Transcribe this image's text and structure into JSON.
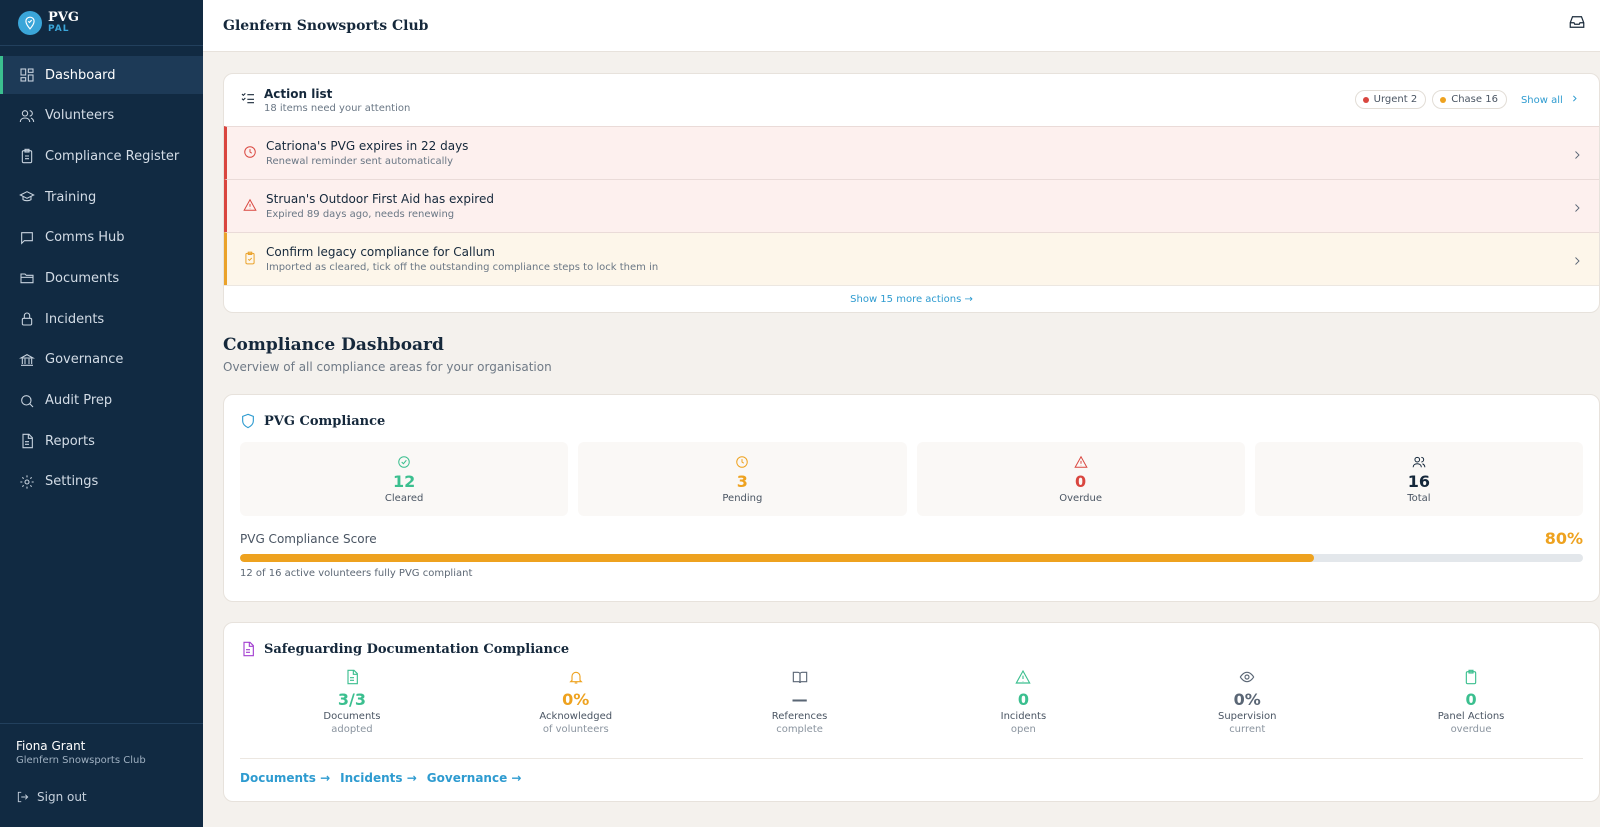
{
  "brand": {
    "name": "PVG",
    "sub": "PAL"
  },
  "sidebar": {
    "items": [
      {
        "label": "Dashboard"
      },
      {
        "label": "Volunteers"
      },
      {
        "label": "Compliance Register"
      },
      {
        "label": "Training"
      },
      {
        "label": "Comms Hub"
      },
      {
        "label": "Documents"
      },
      {
        "label": "Incidents"
      },
      {
        "label": "Governance"
      },
      {
        "label": "Audit Prep"
      },
      {
        "label": "Reports"
      },
      {
        "label": "Settings"
      }
    ],
    "user": {
      "name": "Fiona Grant",
      "org": "Glenfern Snowsports Club"
    },
    "signout": "Sign out"
  },
  "topbar": {
    "title": "Glenfern Snowsports Club"
  },
  "action_list": {
    "title": "Action list",
    "subtitle": "18 items need your attention",
    "chips": {
      "urgent": "Urgent 2",
      "chase": "Chase 16"
    },
    "show_all": "Show all",
    "rows": [
      {
        "title": "Catriona's PVG expires in 22 days",
        "sub": "Renewal reminder sent automatically"
      },
      {
        "title": "Struan's Outdoor First Aid has expired",
        "sub": "Expired 89 days ago, needs renewing"
      },
      {
        "title": "Confirm legacy compliance for Callum",
        "sub": "Imported as cleared, tick off the outstanding compliance steps to lock them in"
      }
    ],
    "more": "Show 15 more actions →"
  },
  "dashboard": {
    "title": "Compliance Dashboard",
    "subtitle": "Overview of all compliance areas for your organisation"
  },
  "pvg": {
    "title": "PVG Compliance",
    "stats": [
      {
        "value": "12",
        "label": "Cleared"
      },
      {
        "value": "3",
        "label": "Pending"
      },
      {
        "value": "0",
        "label": "Overdue"
      },
      {
        "value": "16",
        "label": "Total"
      }
    ],
    "score_label": "PVG Compliance Score",
    "score_value": "80%",
    "score_fraction": 0.8,
    "score_note": "12 of 16 active volunteers fully PVG compliant"
  },
  "safeguarding": {
    "title": "Safeguarding Documentation Compliance",
    "metrics": [
      {
        "value": "3/3",
        "l1": "Documents",
        "l2": "adopted"
      },
      {
        "value": "0%",
        "l1": "Acknowledged",
        "l2": "of volunteers"
      },
      {
        "value": "—",
        "l1": "References",
        "l2": "complete"
      },
      {
        "value": "0",
        "l1": "Incidents",
        "l2": "open"
      },
      {
        "value": "0%",
        "l1": "Supervision",
        "l2": "current"
      },
      {
        "value": "0",
        "l1": "Panel Actions",
        "l2": "overdue"
      }
    ],
    "links": [
      "Documents →",
      "Incidents →",
      "Governance →"
    ]
  },
  "colors": {
    "green": "#3bbf8f",
    "amber": "#eea21f",
    "red": "#d9463f",
    "navy": "#112a42",
    "link": "#2e9bd0"
  }
}
